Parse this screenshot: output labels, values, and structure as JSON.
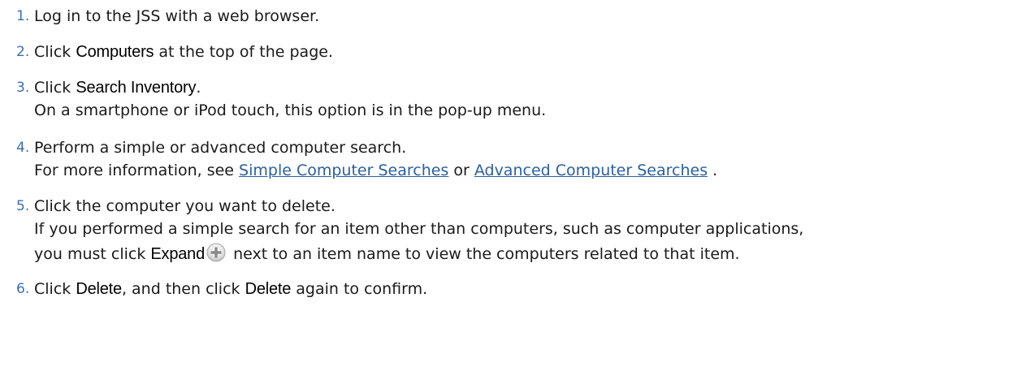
{
  "steps": [
    {
      "number": "1.",
      "text": "Log in to the JSS with a web browser."
    },
    {
      "number": "2.",
      "pre": "Click ",
      "bold": "Computers",
      "post": " at the top of the page."
    },
    {
      "number": "3.",
      "pre": "Click ",
      "bold": "Search Inventory",
      "post": ".",
      "note": "On a smartphone or iPod touch, this option is in the pop-up menu."
    },
    {
      "number": "4.",
      "text": "Perform a simple or advanced computer search.",
      "note_pre": "For more information, see ",
      "link1": "Simple Computer Searches",
      "note_mid": " or ",
      "link2": "Advanced Computer Searches",
      "note_post": " ."
    },
    {
      "number": "5.",
      "text": "Click the computer you want to delete.",
      "note1": "If you performed a simple search for an item other than computers, such as computer applications,",
      "note2_pre": "you must click ",
      "note2_bold": "Expand",
      "note2_post": " next to an item name to view the computers related to that item.",
      "icon": "expand-plus-icon"
    },
    {
      "number": "6.",
      "pre": "Click ",
      "bold1": "Delete",
      "mid": ", and then click ",
      "bold2": "Delete",
      "post": " again to confirm."
    }
  ],
  "colors": {
    "step_number": "#3a6fb0",
    "link": "#2a5fa0",
    "text": "#1a1a1a"
  }
}
